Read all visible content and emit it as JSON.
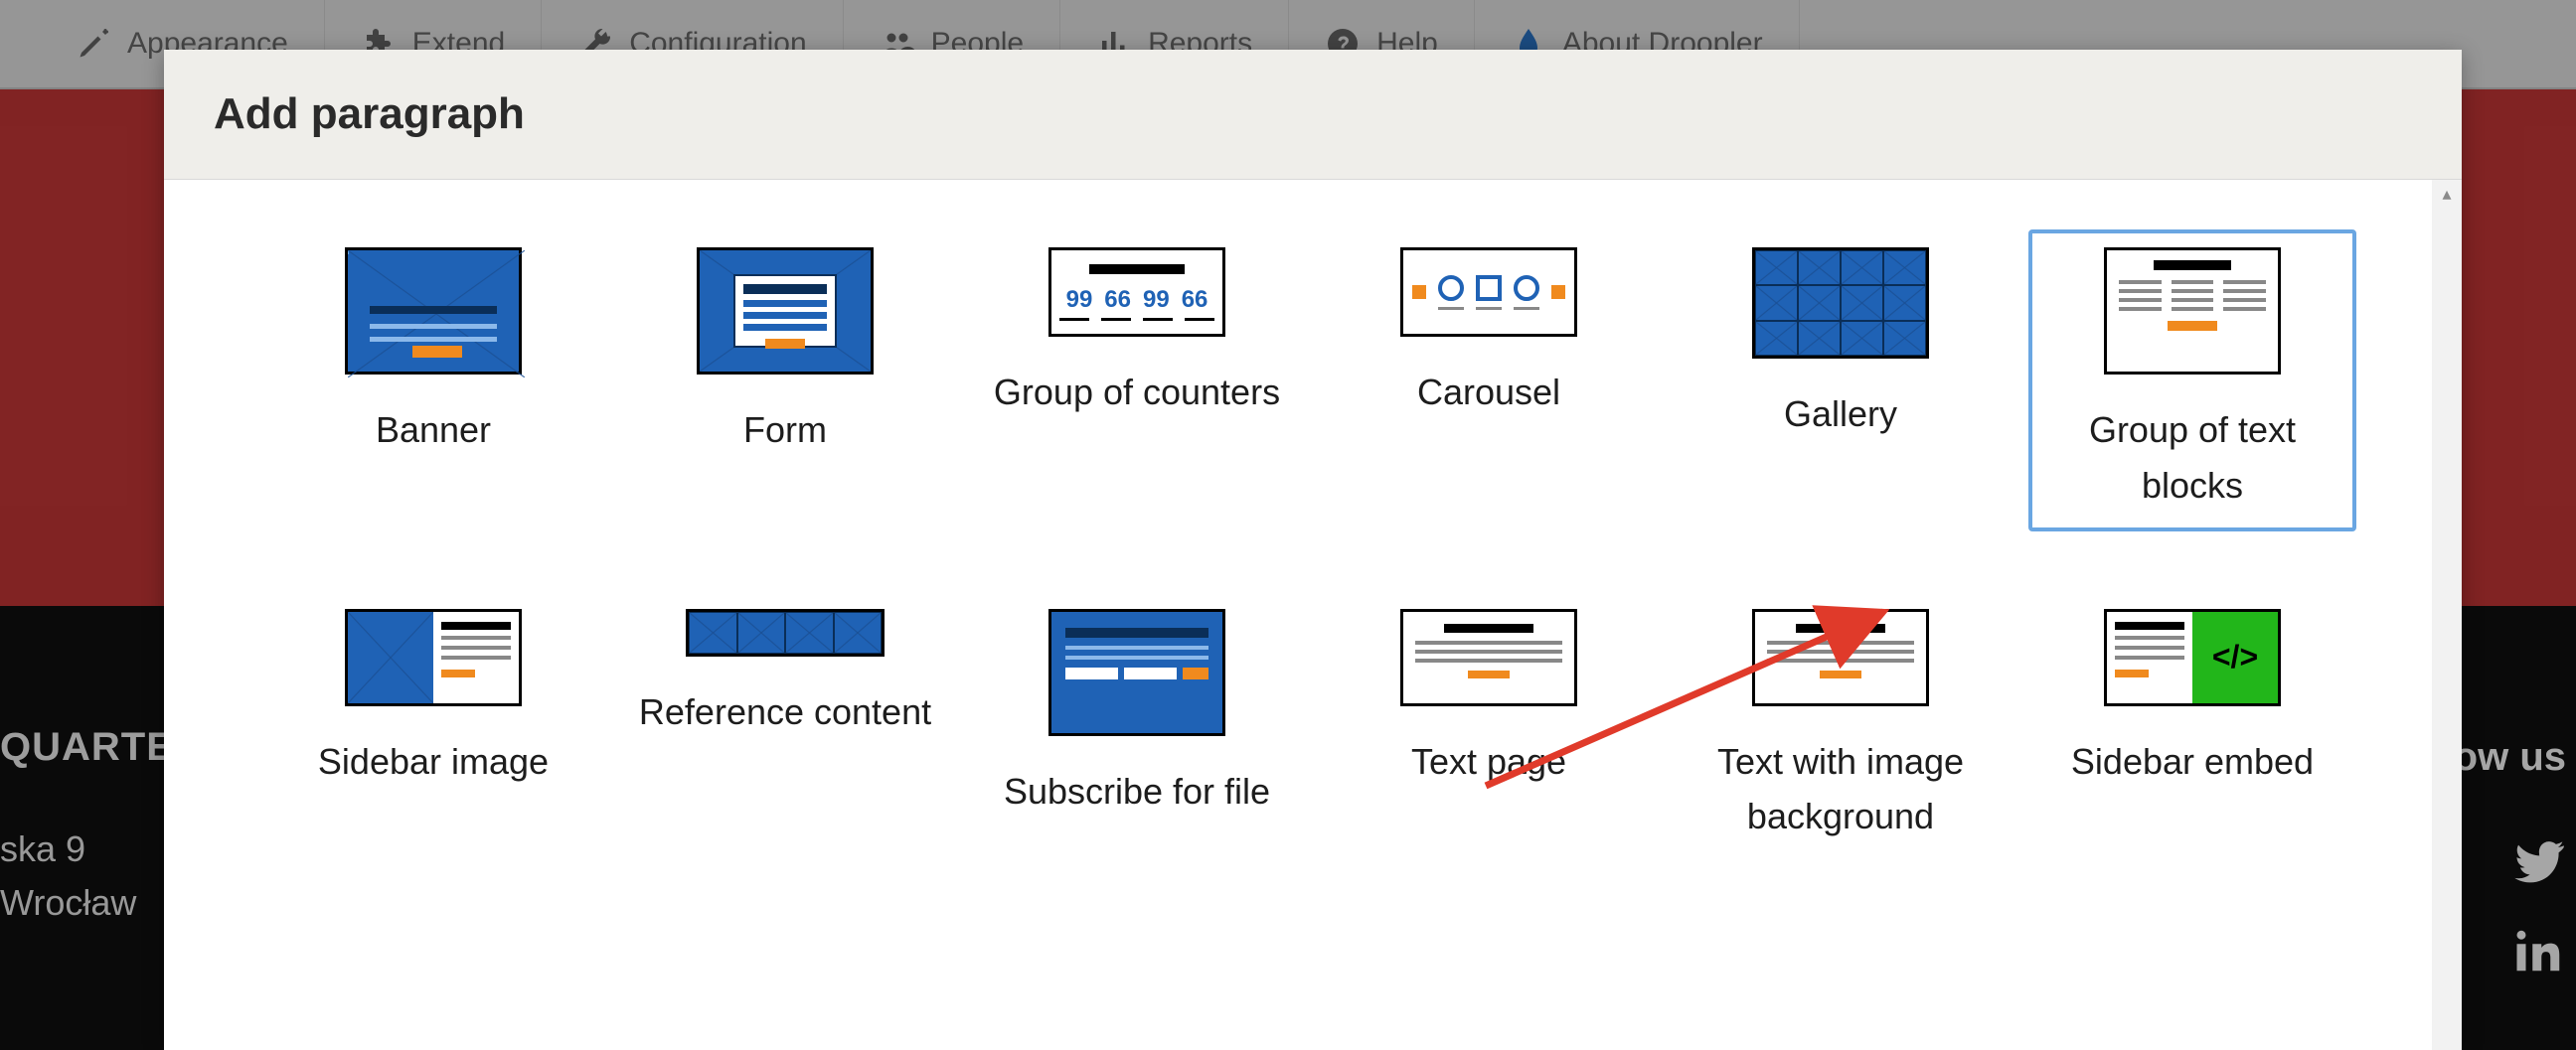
{
  "toolbar": {
    "items": [
      {
        "label": "Appearance"
      },
      {
        "label": "Extend"
      },
      {
        "label": "Configuration"
      },
      {
        "label": "People"
      },
      {
        "label": "Reports"
      },
      {
        "label": "Help"
      },
      {
        "label": "About Droopler"
      }
    ]
  },
  "footer": {
    "headquarters_label": "QUARTER",
    "address_line1": "ska 9",
    "address_line2": "Wrocław",
    "follow_label": "ow us"
  },
  "modal": {
    "title": "Add paragraph",
    "options_row1": [
      {
        "label": "Banner",
        "selected": false
      },
      {
        "label": "Form",
        "selected": false
      },
      {
        "label": "Group of counters",
        "selected": false
      },
      {
        "label": "Carousel",
        "selected": false
      },
      {
        "label": "Gallery",
        "selected": false
      },
      {
        "label": "Group of text blocks",
        "selected": true
      }
    ],
    "options_row2": [
      {
        "label": "Sidebar image",
        "selected": false
      },
      {
        "label": "Reference content",
        "selected": false
      },
      {
        "label": "Subscribe for file",
        "selected": false
      },
      {
        "label": "Text page",
        "selected": false
      },
      {
        "label": "Text with image background",
        "selected": false
      },
      {
        "label": "Sidebar embed",
        "selected": false
      }
    ],
    "counter_sample": [
      "99",
      "66",
      "99",
      "66"
    ],
    "embed_code_label": "</>"
  }
}
